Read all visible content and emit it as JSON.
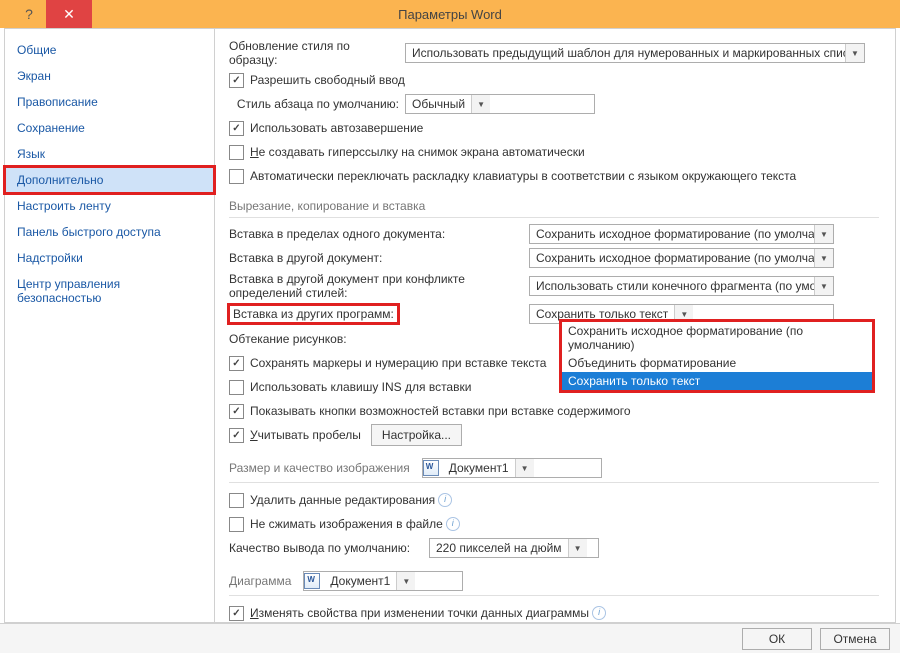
{
  "title": "Параметры Word",
  "sidebar": {
    "items": [
      {
        "label": "Общие"
      },
      {
        "label": "Экран"
      },
      {
        "label": "Правописание"
      },
      {
        "label": "Сохранение"
      },
      {
        "label": "Язык"
      },
      {
        "label": "Дополнительно",
        "active": true,
        "highlight": true
      },
      {
        "label": "Настроить ленту"
      },
      {
        "label": "Панель быстрого доступа"
      },
      {
        "label": "Надстройки"
      },
      {
        "label": "Центр управления безопасностью"
      }
    ]
  },
  "top": {
    "style_update_label": "Обновление стиля по образцу:",
    "style_update_value": "Использовать предыдущий шаблон для нумерованных и маркированных списков",
    "chk_free_input": "Разрешить свободный ввод",
    "default_para_label": "Стиль абзаца по умолчанию:",
    "default_para_value": "Обычный",
    "chk_autocomplete": "Использовать автозавершение",
    "chk_no_hyperlink": "Не создавать гиперссылку на снимок экрана автоматически",
    "chk_auto_switch_layout": "Автоматически переключать раскладку клавиатуры в соответствии с языком окружающего текста"
  },
  "section_cut": "Вырезание, копирование и вставка",
  "paste": {
    "rows": [
      {
        "label": "Вставка в пределах одного документа:",
        "value": "Сохранить исходное форматирование (по умолчанию)"
      },
      {
        "label": "Вставка в другой документ:",
        "value": "Сохранить исходное форматирование (по умолчанию)"
      },
      {
        "label": "Вставка в другой документ при конфликте определений стилей:",
        "value": "Использовать стили конечного фрагмента (по умолчанию)"
      },
      {
        "label": "Вставка из других программ:",
        "value": "Сохранить только текст",
        "highlight_label": true,
        "open": true
      }
    ],
    "dropdown_options": [
      "Сохранить исходное форматирование (по умолчанию)",
      "Объединить форматирование",
      "Сохранить только текст"
    ],
    "pictures_label": "Обтекание рисунков:",
    "chk_keep_bullets": "Сохранять маркеры и нумерацию при вставке текста",
    "chk_ins_key": "Использовать клавишу INS для вставки",
    "chk_show_paste_buttons": "Показывать кнопки возможностей вставки при вставке содержимого",
    "chk_track_spaces": "Учитывать пробелы",
    "btn_settings": "Настройка..."
  },
  "section_image": "Размер и качество изображения",
  "image": {
    "doc": "Документ1",
    "chk_discard_edit": "Удалить данные редактирования",
    "chk_no_compress": "Не сжимать изображения в файле",
    "quality_label": "Качество вывода по умолчанию:",
    "quality_value": "220 пикселей на дюйм"
  },
  "section_chart": "Диаграмма",
  "chart": {
    "doc": "Документ1",
    "chk_mod_props": "Изменять свойства при изменении точки данных диаграммы"
  },
  "footer": {
    "ok": "ОК",
    "cancel": "Отмена"
  }
}
